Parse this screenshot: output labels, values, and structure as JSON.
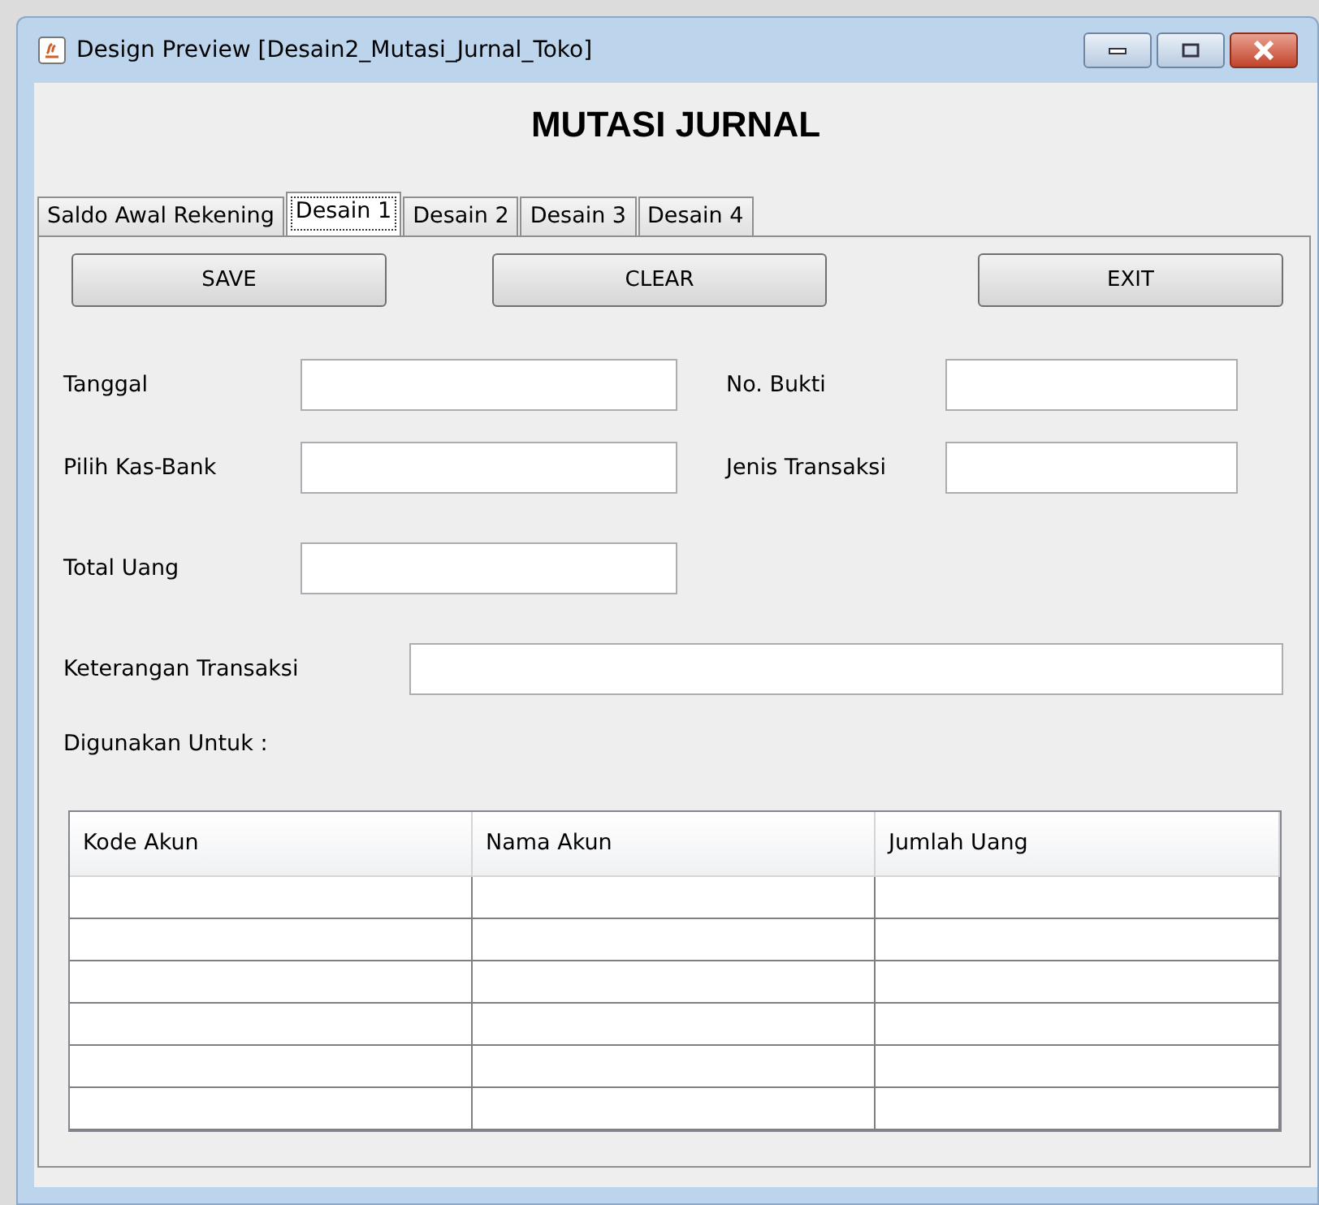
{
  "window": {
    "title": "Design Preview [Desain2_Mutasi_Jurnal_Toko]"
  },
  "heading": "MUTASI JURNAL",
  "tabs": [
    {
      "label": "Saldo Awal Rekening",
      "selected": false
    },
    {
      "label": "Desain 1",
      "selected": true
    },
    {
      "label": "Desain 2",
      "selected": false
    },
    {
      "label": "Desain 3",
      "selected": false
    },
    {
      "label": "Desain 4",
      "selected": false
    }
  ],
  "buttons": [
    "SAVE",
    "CLEAR",
    "EXIT"
  ],
  "field_rows": [
    [
      {
        "label": "Tanggal"
      },
      {
        "label": "No. Bukti"
      }
    ],
    [
      {
        "label": "Pilih Kas-Bank"
      },
      {
        "label": "Jenis Transaksi"
      }
    ],
    [
      {
        "label": "Total Uang"
      }
    ]
  ],
  "description_field": {
    "label": "Keterangan Transaksi"
  },
  "section_label": "Digunakan Untuk :",
  "table": {
    "columns": [
      "Kode Akun",
      "Nama Akun",
      "Jumlah Uang"
    ]
  }
}
